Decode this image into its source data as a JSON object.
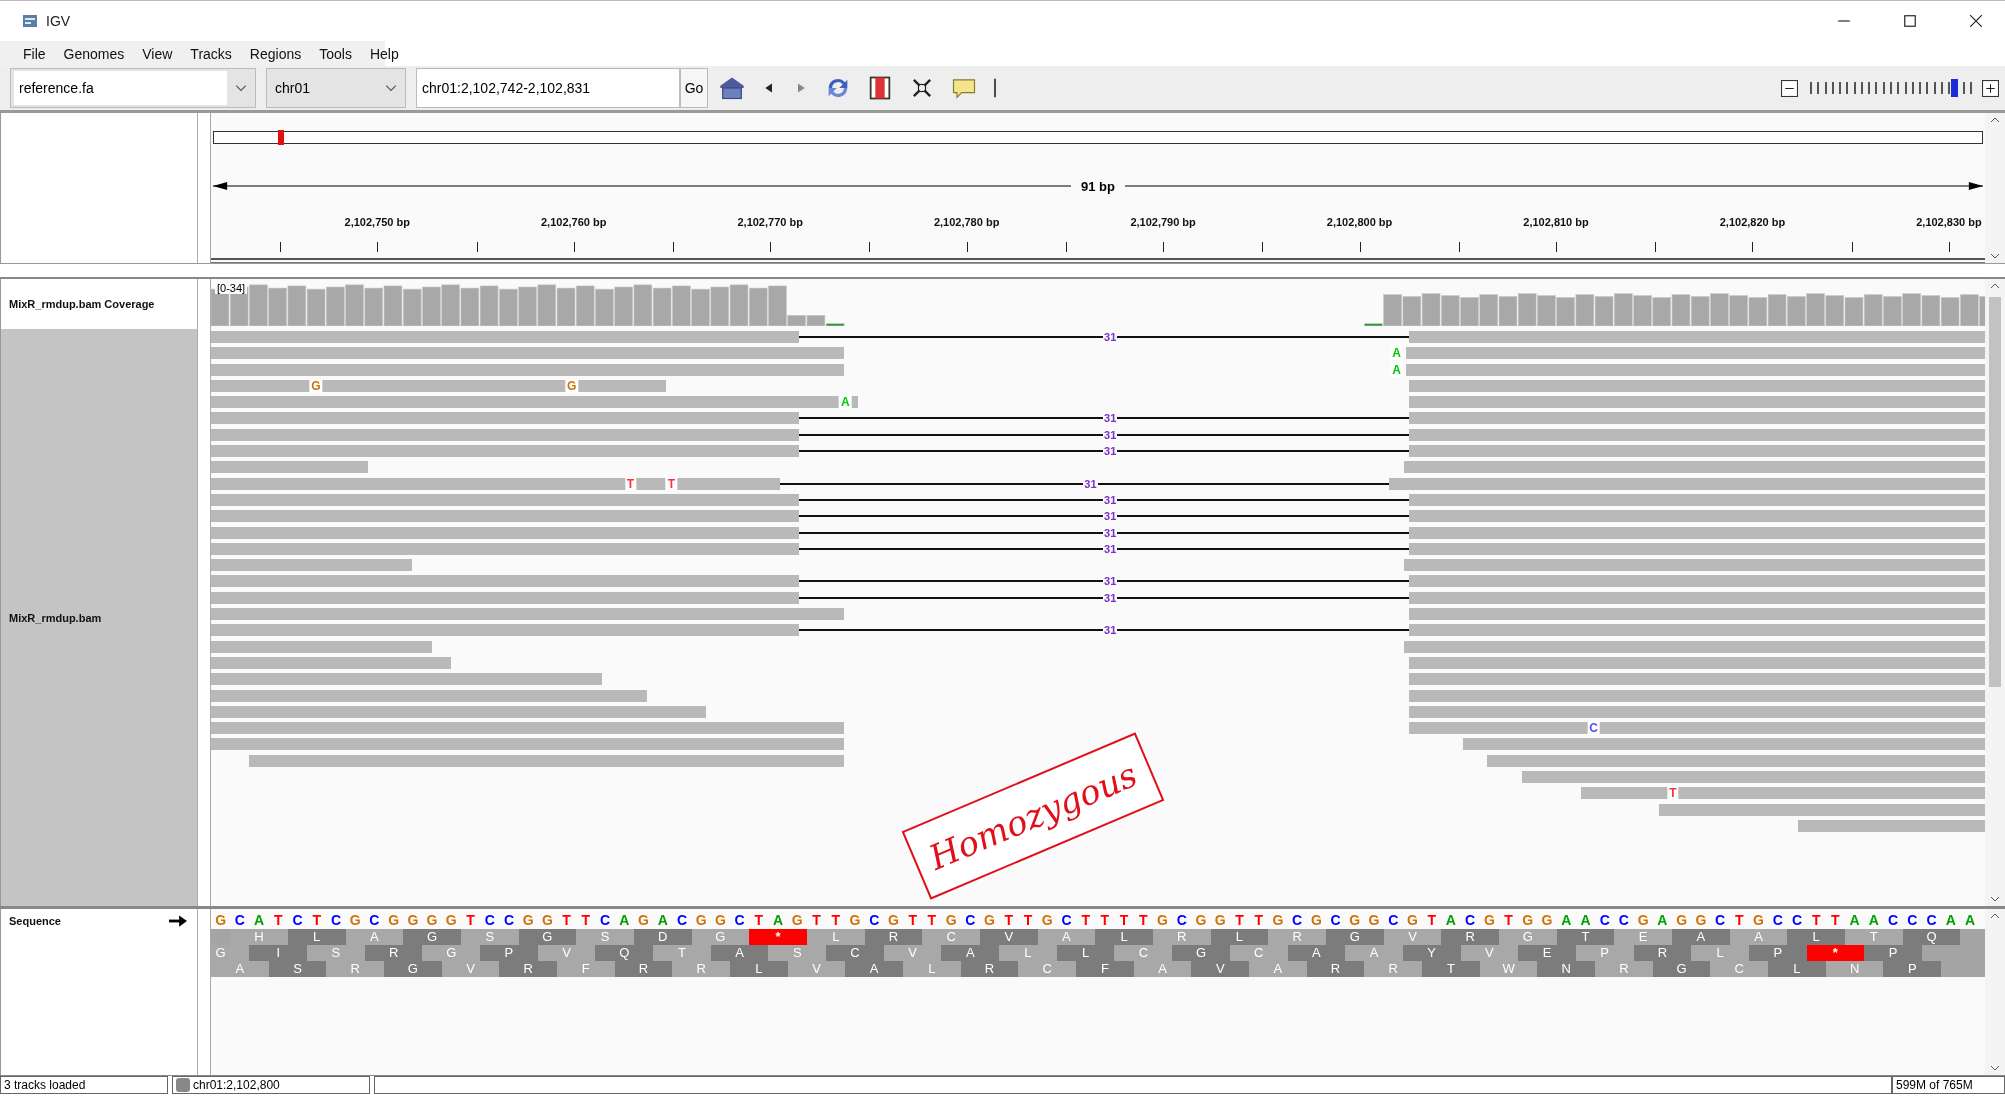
{
  "window": {
    "title": "IGV"
  },
  "menu": [
    "File",
    "Genomes",
    "View",
    "Tracks",
    "Regions",
    "Tools",
    "Help"
  ],
  "toolbar": {
    "genome": "reference.fa",
    "chromosome": "chr01",
    "locus": "chr01:2,102,742-2,102,831",
    "go": "Go",
    "zoom": {
      "level": 0.9
    }
  },
  "ruler": {
    "span": "91 bp",
    "ticks": [
      "2,102,750 bp",
      "2,102,760 bp",
      "2,102,770 bp",
      "2,102,780 bp",
      "2,102,790 bp",
      "2,102,800 bp",
      "2,102,810 bp",
      "2,102,820 bp",
      "2,102,830 bp"
    ]
  },
  "coverage_track": {
    "name": "MixR_rmdup.bam Coverage",
    "range": "[0-34]"
  },
  "alignment_track": {
    "name": "MixR_rmdup.bam",
    "rows": [
      {
        "kind": "spliced",
        "junction": "31"
      },
      {
        "kind": "pair",
        "mismatches": [
          {
            "base": "A",
            "color": "#00c800"
          }
        ]
      },
      {
        "kind": "pair",
        "mismatches": [
          {
            "base": "A",
            "color": "#00c800"
          }
        ]
      },
      {
        "kind": "pair",
        "mismatches": [
          {
            "base": "G",
            "color": "#d17105"
          },
          {
            "base": "G",
            "color": "#d17105"
          }
        ]
      },
      {
        "kind": "pair",
        "mismatches": [
          {
            "base": "A",
            "color": "#00c800"
          }
        ]
      },
      {
        "kind": "spliced",
        "junction": "31"
      },
      {
        "kind": "spliced",
        "junction": "31"
      },
      {
        "kind": "spliced",
        "junction": "31"
      },
      {
        "kind": "pair"
      },
      {
        "kind": "spliced",
        "junction": "31",
        "mismatches": [
          {
            "base": "T",
            "color": "#ff3030"
          },
          {
            "base": "T",
            "color": "#ff3030"
          }
        ]
      },
      {
        "kind": "spliced",
        "junction": "31"
      },
      {
        "kind": "spliced",
        "junction": "31"
      },
      {
        "kind": "spliced",
        "junction": "31"
      },
      {
        "kind": "spliced",
        "junction": "31"
      },
      {
        "kind": "pair"
      },
      {
        "kind": "spliced",
        "junction": "31"
      },
      {
        "kind": "spliced",
        "junction": "31"
      },
      {
        "kind": "pair"
      },
      {
        "kind": "spliced",
        "junction": "31"
      },
      {
        "kind": "pair"
      },
      {
        "kind": "pair"
      },
      {
        "kind": "pair"
      },
      {
        "kind": "pair"
      },
      {
        "kind": "pair"
      },
      {
        "kind": "pair",
        "mismatches": [
          {
            "base": "C",
            "color": "#5050ff"
          }
        ]
      },
      {
        "kind": "pair"
      },
      {
        "kind": "pair"
      },
      {
        "kind": "single"
      },
      {
        "kind": "single",
        "mismatches": [
          {
            "base": "T",
            "color": "#ff3030"
          }
        ]
      },
      {
        "kind": "single"
      },
      {
        "kind": "single"
      }
    ]
  },
  "annotation": {
    "text": "Homozygous"
  },
  "sequence_track": {
    "name": "Sequence",
    "bases": [
      {
        "base": "G",
        "color": "#d17105"
      },
      {
        "base": "C",
        "color": "#0000ff"
      },
      {
        "base": "A",
        "color": "#00a000"
      },
      {
        "base": "T",
        "color": "#ff0000"
      },
      {
        "base": "C",
        "color": "#0000ff"
      },
      {
        "base": "T",
        "color": "#ff0000"
      },
      {
        "base": "C",
        "color": "#0000ff"
      },
      {
        "base": "G",
        "color": "#d17105"
      },
      {
        "base": "C",
        "color": "#0000ff"
      },
      {
        "base": "G",
        "color": "#d17105"
      },
      {
        "base": "G",
        "color": "#d17105"
      },
      {
        "base": "G",
        "color": "#d17105"
      },
      {
        "base": "G",
        "color": "#d17105"
      },
      {
        "base": "T",
        "color": "#ff0000"
      },
      {
        "base": "C",
        "color": "#0000ff"
      },
      {
        "base": "C",
        "color": "#0000ff"
      },
      {
        "base": "G",
        "color": "#d17105"
      },
      {
        "base": "G",
        "color": "#d17105"
      },
      {
        "base": "T",
        "color": "#ff0000"
      },
      {
        "base": "T",
        "color": "#ff0000"
      },
      {
        "base": "C",
        "color": "#0000ff"
      },
      {
        "base": "A",
        "color": "#00a000"
      },
      {
        "base": "G",
        "color": "#d17105"
      },
      {
        "base": "A",
        "color": "#00a000"
      },
      {
        "base": "C",
        "color": "#0000ff"
      },
      {
        "base": "G",
        "color": "#d17105"
      },
      {
        "base": "G",
        "color": "#d17105"
      },
      {
        "base": "C",
        "color": "#0000ff"
      },
      {
        "base": "T",
        "color": "#ff0000"
      },
      {
        "base": "A",
        "color": "#00a000"
      },
      {
        "base": "G",
        "color": "#d17105"
      },
      {
        "base": "T",
        "color": "#ff0000"
      },
      {
        "base": "T",
        "color": "#ff0000"
      },
      {
        "base": "G",
        "color": "#d17105"
      },
      {
        "base": "C",
        "color": "#0000ff"
      },
      {
        "base": "G",
        "color": "#d17105"
      },
      {
        "base": "T",
        "color": "#ff0000"
      },
      {
        "base": "T",
        "color": "#ff0000"
      },
      {
        "base": "G",
        "color": "#d17105"
      },
      {
        "base": "C",
        "color": "#0000ff"
      },
      {
        "base": "G",
        "color": "#d17105"
      },
      {
        "base": "T",
        "color": "#ff0000"
      },
      {
        "base": "T",
        "color": "#ff0000"
      },
      {
        "base": "G",
        "color": "#d17105"
      },
      {
        "base": "C",
        "color": "#0000ff"
      },
      {
        "base": "T",
        "color": "#ff0000"
      },
      {
        "base": "T",
        "color": "#ff0000"
      },
      {
        "base": "T",
        "color": "#ff0000"
      },
      {
        "base": "T",
        "color": "#ff0000"
      },
      {
        "base": "G",
        "color": "#d17105"
      },
      {
        "base": "C",
        "color": "#0000ff"
      },
      {
        "base": "G",
        "color": "#d17105"
      },
      {
        "base": "G",
        "color": "#d17105"
      },
      {
        "base": "T",
        "color": "#ff0000"
      },
      {
        "base": "T",
        "color": "#ff0000"
      },
      {
        "base": "G",
        "color": "#d17105"
      },
      {
        "base": "C",
        "color": "#0000ff"
      },
      {
        "base": "G",
        "color": "#d17105"
      },
      {
        "base": "C",
        "color": "#0000ff"
      },
      {
        "base": "G",
        "color": "#d17105"
      },
      {
        "base": "G",
        "color": "#d17105"
      },
      {
        "base": "C",
        "color": "#0000ff"
      },
      {
        "base": "G",
        "color": "#d17105"
      },
      {
        "base": "T",
        "color": "#ff0000"
      },
      {
        "base": "A",
        "color": "#00a000"
      },
      {
        "base": "C",
        "color": "#0000ff"
      },
      {
        "base": "G",
        "color": "#d17105"
      },
      {
        "base": "T",
        "color": "#ff0000"
      },
      {
        "base": "G",
        "color": "#d17105"
      },
      {
        "base": "G",
        "color": "#d17105"
      },
      {
        "base": "A",
        "color": "#00a000"
      },
      {
        "base": "A",
        "color": "#00a000"
      },
      {
        "base": "C",
        "color": "#0000ff"
      },
      {
        "base": "C",
        "color": "#0000ff"
      },
      {
        "base": "G",
        "color": "#d17105"
      },
      {
        "base": "A",
        "color": "#00a000"
      },
      {
        "base": "G",
        "color": "#d17105"
      },
      {
        "base": "G",
        "color": "#d17105"
      },
      {
        "base": "C",
        "color": "#0000ff"
      },
      {
        "base": "T",
        "color": "#ff0000"
      },
      {
        "base": "G",
        "color": "#d17105"
      },
      {
        "base": "C",
        "color": "#0000ff"
      },
      {
        "base": "C",
        "color": "#0000ff"
      },
      {
        "base": "T",
        "color": "#ff0000"
      },
      {
        "base": "T",
        "color": "#ff0000"
      },
      {
        "base": "A",
        "color": "#00a000"
      },
      {
        "base": "A",
        "color": "#00a000"
      },
      {
        "base": "C",
        "color": "#0000ff"
      },
      {
        "base": "C",
        "color": "#0000ff"
      },
      {
        "base": "C",
        "color": "#0000ff"
      },
      {
        "base": "A",
        "color": "#00a000"
      },
      {
        "base": "A",
        "color": "#00a000"
      }
    ],
    "frames": [
      [
        {
          "aa": "H",
          "stop": false
        },
        {
          "aa": "L",
          "stop": false
        },
        {
          "aa": "A",
          "stop": false
        },
        {
          "aa": "G",
          "stop": false
        },
        {
          "aa": "S",
          "stop": false
        },
        {
          "aa": "G",
          "stop": false
        },
        {
          "aa": "S",
          "stop": false
        },
        {
          "aa": "D",
          "stop": false
        },
        {
          "aa": "G",
          "stop": false
        },
        {
          "aa": "*",
          "stop": true
        },
        {
          "aa": "L",
          "stop": false
        },
        {
          "aa": "R",
          "stop": false
        },
        {
          "aa": "C",
          "stop": false
        },
        {
          "aa": "V",
          "stop": false
        },
        {
          "aa": "A",
          "stop": false
        },
        {
          "aa": "L",
          "stop": false
        },
        {
          "aa": "R",
          "stop": false
        },
        {
          "aa": "L",
          "stop": false
        },
        {
          "aa": "R",
          "stop": false
        },
        {
          "aa": "G",
          "stop": false
        },
        {
          "aa": "V",
          "stop": false
        },
        {
          "aa": "R",
          "stop": false
        },
        {
          "aa": "G",
          "stop": false
        },
        {
          "aa": "T",
          "stop": false
        },
        {
          "aa": "E",
          "stop": false
        },
        {
          "aa": "A",
          "stop": false
        },
        {
          "aa": "A",
          "stop": false
        },
        {
          "aa": "L",
          "stop": false
        },
        {
          "aa": "T",
          "stop": false
        },
        {
          "aa": "Q",
          "stop": false
        }
      ],
      [
        {
          "aa": "G",
          "stop": false
        },
        {
          "aa": "I",
          "stop": false
        },
        {
          "aa": "S",
          "stop": false
        },
        {
          "aa": "R",
          "stop": false
        },
        {
          "aa": "G",
          "stop": false
        },
        {
          "aa": "P",
          "stop": false
        },
        {
          "aa": "V",
          "stop": false
        },
        {
          "aa": "Q",
          "stop": false
        },
        {
          "aa": "T",
          "stop": false
        },
        {
          "aa": "A",
          "stop": false
        },
        {
          "aa": "S",
          "stop": false
        },
        {
          "aa": "C",
          "stop": false
        },
        {
          "aa": "V",
          "stop": false
        },
        {
          "aa": "A",
          "stop": false
        },
        {
          "aa": "L",
          "stop": false
        },
        {
          "aa": "L",
          "stop": false
        },
        {
          "aa": "C",
          "stop": false
        },
        {
          "aa": "G",
          "stop": false
        },
        {
          "aa": "C",
          "stop": false
        },
        {
          "aa": "A",
          "stop": false
        },
        {
          "aa": "A",
          "stop": false
        },
        {
          "aa": "Y",
          "stop": false
        },
        {
          "aa": "V",
          "stop": false
        },
        {
          "aa": "E",
          "stop": false
        },
        {
          "aa": "P",
          "stop": false
        },
        {
          "aa": "R",
          "stop": false
        },
        {
          "aa": "L",
          "stop": false
        },
        {
          "aa": "P",
          "stop": false
        },
        {
          "aa": "*",
          "stop": true
        },
        {
          "aa": "P",
          "stop": false
        }
      ],
      [
        {
          "aa": "A",
          "stop": false
        },
        {
          "aa": "S",
          "stop": false
        },
        {
          "aa": "R",
          "stop": false
        },
        {
          "aa": "G",
          "stop": false
        },
        {
          "aa": "V",
          "stop": false
        },
        {
          "aa": "R",
          "stop": false
        },
        {
          "aa": "F",
          "stop": false
        },
        {
          "aa": "R",
          "stop": false
        },
        {
          "aa": "R",
          "stop": false
        },
        {
          "aa": "L",
          "stop": false
        },
        {
          "aa": "V",
          "stop": false
        },
        {
          "aa": "A",
          "stop": false
        },
        {
          "aa": "L",
          "stop": false
        },
        {
          "aa": "R",
          "stop": false
        },
        {
          "aa": "C",
          "stop": false
        },
        {
          "aa": "F",
          "stop": false
        },
        {
          "aa": "A",
          "stop": false
        },
        {
          "aa": "V",
          "stop": false
        },
        {
          "aa": "A",
          "stop": false
        },
        {
          "aa": "R",
          "stop": false
        },
        {
          "aa": "R",
          "stop": false
        },
        {
          "aa": "T",
          "stop": false
        },
        {
          "aa": "W",
          "stop": false
        },
        {
          "aa": "N",
          "stop": false
        },
        {
          "aa": "R",
          "stop": false
        },
        {
          "aa": "G",
          "stop": false
        },
        {
          "aa": "C",
          "stop": false
        },
        {
          "aa": "L",
          "stop": false
        },
        {
          "aa": "N",
          "stop": false
        },
        {
          "aa": "P",
          "stop": false
        }
      ]
    ]
  },
  "status_bar": {
    "message": "3 tracks loaded",
    "position": "chr01:2,102,800",
    "memory": "599M of 765M"
  }
}
